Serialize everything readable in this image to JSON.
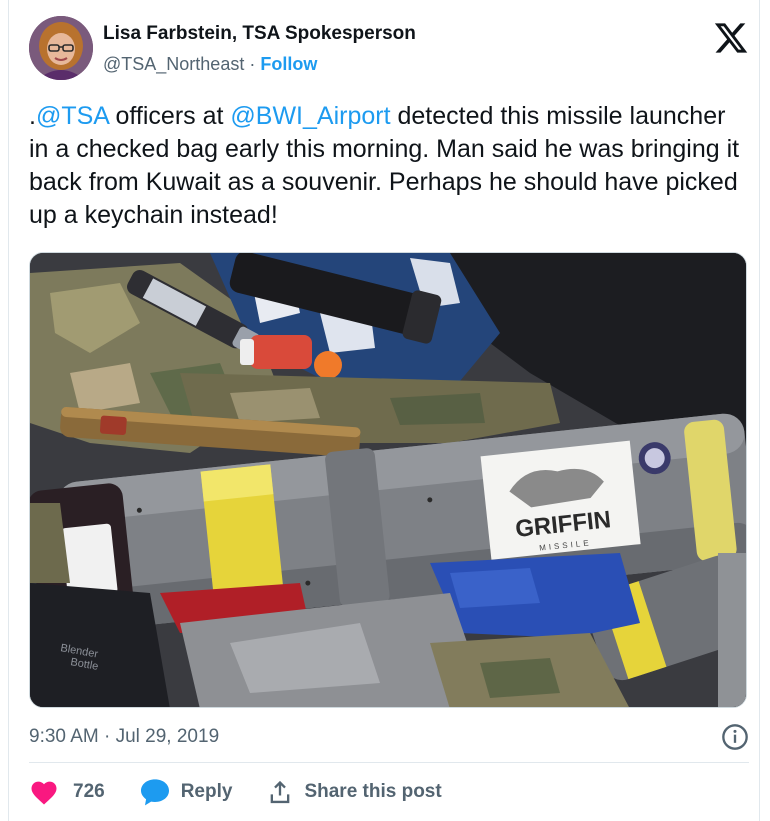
{
  "author": {
    "name": "Lisa Farbstein, TSA Spokesperson",
    "handle": "@TSA_Northeast",
    "separator": "·",
    "follow_label": "Follow"
  },
  "tweet": {
    "lead": ".",
    "mention_1": "@TSA",
    "text_1": " officers at ",
    "mention_2": "@BWI_Airport",
    "text_2": " detected this missile launcher in a checked bag early this morning. Man said he was bringing it back from Kuwait as a souvenir. Perhaps he should have picked up a keychain instead!"
  },
  "media": {
    "sticker_brand": "GRIFFIN",
    "sticker_sub": "MISSILE",
    "bottle_text_1": "Blender",
    "bottle_text_2": "Bottle"
  },
  "meta": {
    "time": "9:30 AM",
    "separator": "·",
    "date": "Jul 29, 2019"
  },
  "actions": {
    "like_count": "726",
    "reply_label": "Reply",
    "share_label": "Share this post"
  },
  "colors": {
    "accent": "#1d9bf0",
    "like": "#f91880",
    "text": "#0f1419",
    "muted": "#536471"
  },
  "icons": {
    "logo": "x-logo-icon",
    "info": "info-icon",
    "like": "heart-icon",
    "reply": "speech-bubble-icon",
    "share": "share-upload-icon"
  }
}
